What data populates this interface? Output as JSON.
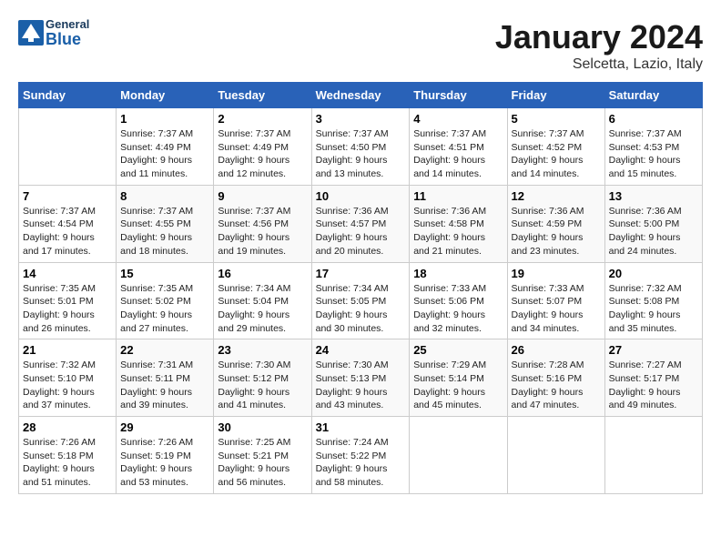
{
  "logo": {
    "line1": "General",
    "line2": "Blue"
  },
  "title": "January 2024",
  "subtitle": "Selcetta, Lazio, Italy",
  "weekdays": [
    "Sunday",
    "Monday",
    "Tuesday",
    "Wednesday",
    "Thursday",
    "Friday",
    "Saturday"
  ],
  "weeks": [
    [
      {
        "day": "",
        "info": ""
      },
      {
        "day": "1",
        "info": "Sunrise: 7:37 AM\nSunset: 4:49 PM\nDaylight: 9 hours\nand 11 minutes."
      },
      {
        "day": "2",
        "info": "Sunrise: 7:37 AM\nSunset: 4:49 PM\nDaylight: 9 hours\nand 12 minutes."
      },
      {
        "day": "3",
        "info": "Sunrise: 7:37 AM\nSunset: 4:50 PM\nDaylight: 9 hours\nand 13 minutes."
      },
      {
        "day": "4",
        "info": "Sunrise: 7:37 AM\nSunset: 4:51 PM\nDaylight: 9 hours\nand 14 minutes."
      },
      {
        "day": "5",
        "info": "Sunrise: 7:37 AM\nSunset: 4:52 PM\nDaylight: 9 hours\nand 14 minutes."
      },
      {
        "day": "6",
        "info": "Sunrise: 7:37 AM\nSunset: 4:53 PM\nDaylight: 9 hours\nand 15 minutes."
      }
    ],
    [
      {
        "day": "7",
        "info": "Sunrise: 7:37 AM\nSunset: 4:54 PM\nDaylight: 9 hours\nand 17 minutes."
      },
      {
        "day": "8",
        "info": "Sunrise: 7:37 AM\nSunset: 4:55 PM\nDaylight: 9 hours\nand 18 minutes."
      },
      {
        "day": "9",
        "info": "Sunrise: 7:37 AM\nSunset: 4:56 PM\nDaylight: 9 hours\nand 19 minutes."
      },
      {
        "day": "10",
        "info": "Sunrise: 7:36 AM\nSunset: 4:57 PM\nDaylight: 9 hours\nand 20 minutes."
      },
      {
        "day": "11",
        "info": "Sunrise: 7:36 AM\nSunset: 4:58 PM\nDaylight: 9 hours\nand 21 minutes."
      },
      {
        "day": "12",
        "info": "Sunrise: 7:36 AM\nSunset: 4:59 PM\nDaylight: 9 hours\nand 23 minutes."
      },
      {
        "day": "13",
        "info": "Sunrise: 7:36 AM\nSunset: 5:00 PM\nDaylight: 9 hours\nand 24 minutes."
      }
    ],
    [
      {
        "day": "14",
        "info": "Sunrise: 7:35 AM\nSunset: 5:01 PM\nDaylight: 9 hours\nand 26 minutes."
      },
      {
        "day": "15",
        "info": "Sunrise: 7:35 AM\nSunset: 5:02 PM\nDaylight: 9 hours\nand 27 minutes."
      },
      {
        "day": "16",
        "info": "Sunrise: 7:34 AM\nSunset: 5:04 PM\nDaylight: 9 hours\nand 29 minutes."
      },
      {
        "day": "17",
        "info": "Sunrise: 7:34 AM\nSunset: 5:05 PM\nDaylight: 9 hours\nand 30 minutes."
      },
      {
        "day": "18",
        "info": "Sunrise: 7:33 AM\nSunset: 5:06 PM\nDaylight: 9 hours\nand 32 minutes."
      },
      {
        "day": "19",
        "info": "Sunrise: 7:33 AM\nSunset: 5:07 PM\nDaylight: 9 hours\nand 34 minutes."
      },
      {
        "day": "20",
        "info": "Sunrise: 7:32 AM\nSunset: 5:08 PM\nDaylight: 9 hours\nand 35 minutes."
      }
    ],
    [
      {
        "day": "21",
        "info": "Sunrise: 7:32 AM\nSunset: 5:10 PM\nDaylight: 9 hours\nand 37 minutes."
      },
      {
        "day": "22",
        "info": "Sunrise: 7:31 AM\nSunset: 5:11 PM\nDaylight: 9 hours\nand 39 minutes."
      },
      {
        "day": "23",
        "info": "Sunrise: 7:30 AM\nSunset: 5:12 PM\nDaylight: 9 hours\nand 41 minutes."
      },
      {
        "day": "24",
        "info": "Sunrise: 7:30 AM\nSunset: 5:13 PM\nDaylight: 9 hours\nand 43 minutes."
      },
      {
        "day": "25",
        "info": "Sunrise: 7:29 AM\nSunset: 5:14 PM\nDaylight: 9 hours\nand 45 minutes."
      },
      {
        "day": "26",
        "info": "Sunrise: 7:28 AM\nSunset: 5:16 PM\nDaylight: 9 hours\nand 47 minutes."
      },
      {
        "day": "27",
        "info": "Sunrise: 7:27 AM\nSunset: 5:17 PM\nDaylight: 9 hours\nand 49 minutes."
      }
    ],
    [
      {
        "day": "28",
        "info": "Sunrise: 7:26 AM\nSunset: 5:18 PM\nDaylight: 9 hours\nand 51 minutes."
      },
      {
        "day": "29",
        "info": "Sunrise: 7:26 AM\nSunset: 5:19 PM\nDaylight: 9 hours\nand 53 minutes."
      },
      {
        "day": "30",
        "info": "Sunrise: 7:25 AM\nSunset: 5:21 PM\nDaylight: 9 hours\nand 56 minutes."
      },
      {
        "day": "31",
        "info": "Sunrise: 7:24 AM\nSunset: 5:22 PM\nDaylight: 9 hours\nand 58 minutes."
      },
      {
        "day": "",
        "info": ""
      },
      {
        "day": "",
        "info": ""
      },
      {
        "day": "",
        "info": ""
      }
    ]
  ]
}
